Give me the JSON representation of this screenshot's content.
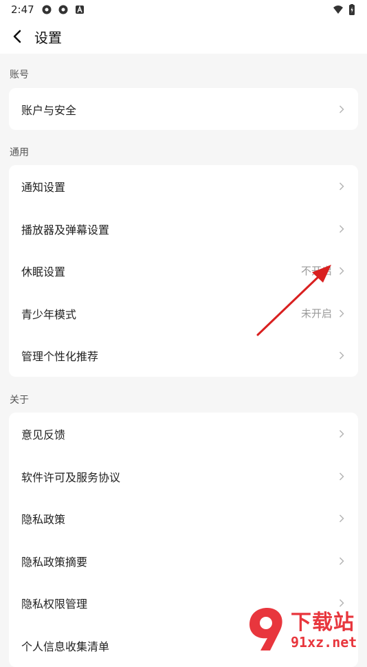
{
  "status": {
    "time": "2:47"
  },
  "header": {
    "title": "设置"
  },
  "sections": [
    {
      "label": "账号",
      "items": [
        {
          "label": "账户与安全",
          "value": ""
        }
      ]
    },
    {
      "label": "通用",
      "items": [
        {
          "label": "通知设置",
          "value": ""
        },
        {
          "label": "播放器及弹幕设置",
          "value": ""
        },
        {
          "label": "休眠设置",
          "value": "不开启"
        },
        {
          "label": "青少年模式",
          "value": "未开启"
        },
        {
          "label": "管理个性化推荐",
          "value": ""
        }
      ]
    },
    {
      "label": "关于",
      "items": [
        {
          "label": "意见反馈",
          "value": ""
        },
        {
          "label": "软件许可及服务协议",
          "value": ""
        },
        {
          "label": "隐私政策",
          "value": ""
        },
        {
          "label": "隐私政策摘要",
          "value": ""
        },
        {
          "label": "隐私权限管理",
          "value": ""
        },
        {
          "label": "个人信息收集清单",
          "value": ""
        }
      ]
    }
  ],
  "watermark": {
    "brand": "下载站",
    "domain": "91xz.net"
  },
  "colors": {
    "background": "#f6f6f6",
    "card": "#ffffff",
    "annotation_arrow": "#d92020",
    "watermark": "#e8363d"
  }
}
